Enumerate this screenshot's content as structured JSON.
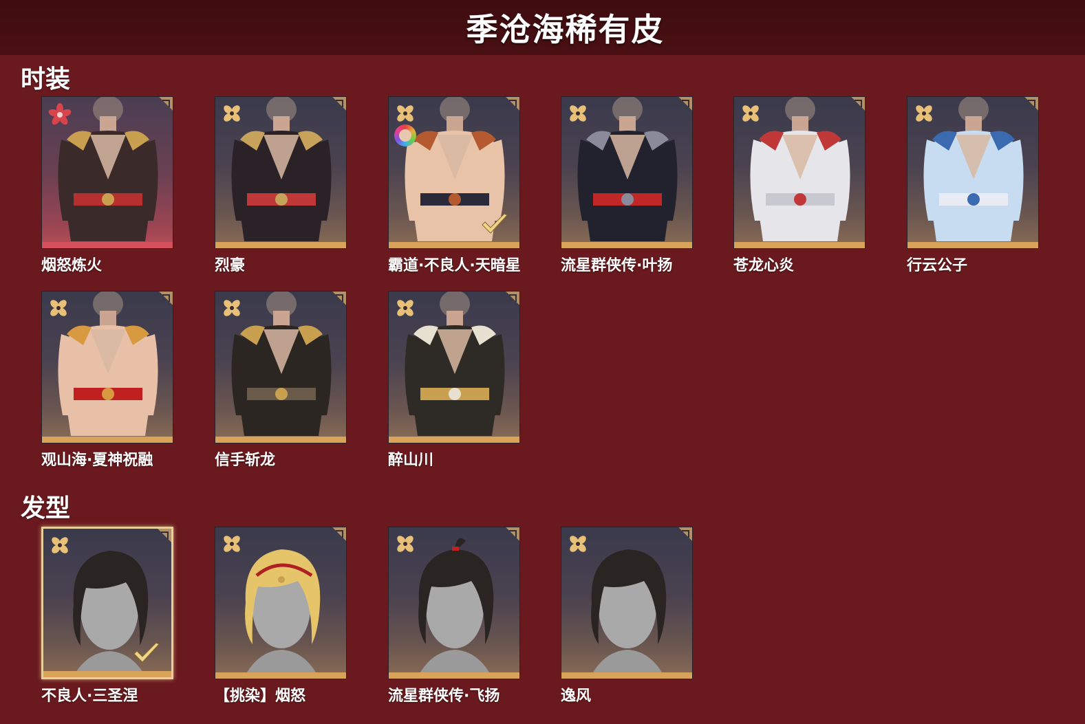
{
  "page": {
    "title": "季沧海稀有皮"
  },
  "sections": {
    "costumes": {
      "title": "时装",
      "items": [
        {
          "name": "烟怒炼火",
          "rarity_icon": "red-flower-icon",
          "theme": "red"
        },
        {
          "name": "烈豪",
          "rarity_icon": "gold-flower-icon",
          "theme": "gold"
        },
        {
          "name": "霸道·不良人·天暗星",
          "rarity_icon": "gold-flower-icon",
          "theme": "gold",
          "dye_icon": "color-ring-icon",
          "owned": true
        },
        {
          "name": "流星群侠传·叶扬",
          "rarity_icon": "gold-flower-icon",
          "theme": "gold"
        },
        {
          "name": "苍龙心炎",
          "rarity_icon": "gold-flower-icon",
          "theme": "gold"
        },
        {
          "name": "行云公子",
          "rarity_icon": "gold-flower-icon",
          "theme": "gold"
        },
        {
          "name": "观山海·夏神祝融",
          "rarity_icon": "gold-flower-icon",
          "theme": "gold"
        },
        {
          "name": "信手斩龙",
          "rarity_icon": "gold-flower-icon",
          "theme": "gold"
        },
        {
          "name": "醉山川",
          "rarity_icon": "gold-flower-icon",
          "theme": "gold"
        }
      ]
    },
    "hairstyles": {
      "title": "发型",
      "items": [
        {
          "name": "不良人·三圣涅",
          "rarity_icon": "gold-flower-icon",
          "theme": "gold",
          "owned": true,
          "selected": true
        },
        {
          "name": "【挑染】烟怒",
          "rarity_icon": "gold-flower-icon",
          "theme": "gold"
        },
        {
          "name": "流星群侠传·飞扬",
          "rarity_icon": "gold-flower-icon",
          "theme": "gold"
        },
        {
          "name": "逸风",
          "rarity_icon": "gold-flower-icon",
          "theme": "gold"
        }
      ]
    }
  },
  "colors": {
    "background": "#6a1a1e",
    "header": "#420d10",
    "gold_accent": "#d9a45a",
    "red_accent": "#d4505a"
  }
}
